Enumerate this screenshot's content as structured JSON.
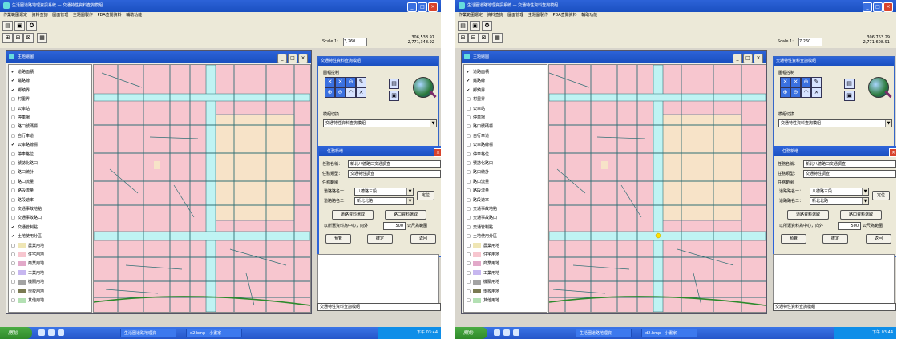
{
  "screens": [
    {
      "title": "生活圈道路地理資訊系統 — 交通特性資料查詢模組",
      "menu": [
        "作業範圍選定",
        "資料查詢",
        "圖面管理",
        "主題圖製作",
        "PDA查閱資料",
        "輔助功能"
      ],
      "scale_label": "Scale 1:",
      "scale_value": "7,260",
      "coord_x": "306,538.97",
      "coord_y": "2,771,348.92",
      "map_window_title": "主題繪圖",
      "layers": [
        {
          "label": "道路面積",
          "checked": true,
          "swatch": ""
        },
        {
          "label": "鐵路線",
          "checked": true,
          "swatch": ""
        },
        {
          "label": "鄉鎮界",
          "checked": true,
          "swatch": ""
        },
        {
          "label": "村里界",
          "checked": false,
          "swatch": ""
        },
        {
          "label": "公車站",
          "checked": false,
          "swatch": ""
        },
        {
          "label": "停車場",
          "checked": false,
          "swatch": ""
        },
        {
          "label": "路口號碼標",
          "checked": false,
          "swatch": ""
        },
        {
          "label": "自行車道",
          "checked": false,
          "swatch": ""
        },
        {
          "label": "公車路線標",
          "checked": true,
          "swatch": ""
        },
        {
          "label": "停車格位",
          "checked": false,
          "swatch": ""
        },
        {
          "label": "號誌化路口",
          "checked": false,
          "swatch": ""
        },
        {
          "label": "路口統計",
          "checked": false,
          "swatch": ""
        },
        {
          "label": "路口流量",
          "checked": false,
          "swatch": ""
        },
        {
          "label": "路段流量",
          "checked": false,
          "swatch": ""
        },
        {
          "label": "路段速率",
          "checked": false,
          "swatch": ""
        },
        {
          "label": "交通事故地點",
          "checked": false,
          "swatch": ""
        },
        {
          "label": "交通事故路口",
          "checked": false,
          "swatch": ""
        },
        {
          "label": "交通管制點",
          "checked": true,
          "swatch": ""
        },
        {
          "label": "土地使用分區",
          "checked": true,
          "swatch": ""
        },
        {
          "label": "農業用地",
          "checked": false,
          "swatch": "#efe6b5"
        },
        {
          "label": "住宅用地",
          "checked": false,
          "swatch": "#f7c6cf"
        },
        {
          "label": "商業用地",
          "checked": false,
          "swatch": "#e2a9c9"
        },
        {
          "label": "工業用地",
          "checked": false,
          "swatch": "#c7b7f0"
        },
        {
          "label": "機關用地",
          "checked": false,
          "swatch": "#a3a3a3"
        },
        {
          "label": "學校用地",
          "checked": false,
          "swatch": "#7a7a52"
        },
        {
          "label": "其他用地",
          "checked": false,
          "swatch": "#b3e0b3"
        }
      ],
      "panel_title": "交通特性資料查詢模組",
      "panel_tools_label": "圖幅控制",
      "panel_mode_label": "模組切換",
      "panel_mode_value": "交通特性資料查詢模組",
      "dialog_title": "任務新增",
      "task_name_label": "任務名稱：",
      "task_name_value": "新北八德路口交通調查",
      "task_type_label": "任務類型：",
      "task_type_value": "交通特性調查",
      "task_range_label": "任務範圍",
      "road1_label": "道路路名一：",
      "road1_value": "八德路三段",
      "road2_label": "道路路名二：",
      "road2_value": "新北北路",
      "locate_label": "定位",
      "select_road_label": "道路資料選取",
      "select_intersection_label": "路口資料選取",
      "radius_label": "以所選資料為中心，向外",
      "radius_value": "500",
      "radius_unit": "公尺為範圍",
      "preview_label": "預覽",
      "ok_label": "確定",
      "back_label": "返回",
      "bottom_select_value": "交通特性資料查詢模組",
      "start_label": "開始",
      "task1": "生活圈道路地理資",
      "task2": "d2.bmp - 小畫家",
      "clock": "下午 03:44"
    },
    {
      "title": "生活圈道路地理資訊系統 — 交通特性資料查詢模組",
      "menu": [
        "作業範圍選定",
        "資料查詢",
        "圖面管理",
        "主題圖製作",
        "PDA查閱資料",
        "輔助功能"
      ],
      "scale_label": "Scale 1:",
      "scale_value": "7,260",
      "coord_x": "306,763.29",
      "coord_y": "2,771,608.91",
      "map_window_title": "主題繪圖",
      "layers": [
        {
          "label": "道路面積",
          "checked": true,
          "swatch": ""
        },
        {
          "label": "鐵路線",
          "checked": true,
          "swatch": ""
        },
        {
          "label": "鄉鎮界",
          "checked": true,
          "swatch": ""
        },
        {
          "label": "村里界",
          "checked": false,
          "swatch": ""
        },
        {
          "label": "公車站",
          "checked": false,
          "swatch": ""
        },
        {
          "label": "停車場",
          "checked": false,
          "swatch": ""
        },
        {
          "label": "路口號碼標",
          "checked": false,
          "swatch": ""
        },
        {
          "label": "自行車道",
          "checked": false,
          "swatch": ""
        },
        {
          "label": "公車路線標",
          "checked": false,
          "swatch": ""
        },
        {
          "label": "停車格位",
          "checked": false,
          "swatch": ""
        },
        {
          "label": "號誌化路口",
          "checked": false,
          "swatch": ""
        },
        {
          "label": "路口統計",
          "checked": false,
          "swatch": ""
        },
        {
          "label": "路口流量",
          "checked": false,
          "swatch": ""
        },
        {
          "label": "路段流量",
          "checked": false,
          "swatch": ""
        },
        {
          "label": "路段速率",
          "checked": false,
          "swatch": ""
        },
        {
          "label": "交通事故地點",
          "checked": false,
          "swatch": ""
        },
        {
          "label": "交通事故路口",
          "checked": false,
          "swatch": ""
        },
        {
          "label": "交通管制點",
          "checked": false,
          "swatch": ""
        },
        {
          "label": "土地使用分區",
          "checked": false,
          "swatch": ""
        },
        {
          "label": "農業用地",
          "checked": false,
          "swatch": "#efe6b5"
        },
        {
          "label": "住宅用地",
          "checked": false,
          "swatch": "#f7c6cf"
        },
        {
          "label": "商業用地",
          "checked": false,
          "swatch": "#e2a9c9"
        },
        {
          "label": "工業用地",
          "checked": false,
          "swatch": "#c7b7f0"
        },
        {
          "label": "機關用地",
          "checked": false,
          "swatch": "#a3a3a3"
        },
        {
          "label": "學校用地",
          "checked": false,
          "swatch": "#7a7a52"
        },
        {
          "label": "其他用地",
          "checked": false,
          "swatch": "#b3e0b3"
        }
      ],
      "panel_title": "交通特性資料查詢模組",
      "panel_tools_label": "圖幅控制",
      "panel_mode_label": "模組切換",
      "panel_mode_value": "交通特性資料查詢模組",
      "dialog_title": "任務新增",
      "task_name_label": "任務名稱：",
      "task_name_value": "新北八德路口交通調查",
      "task_type_label": "任務類型：",
      "task_type_value": "交通特性調查",
      "task_range_label": "任務範圍",
      "road1_label": "道路路名一：",
      "road1_value": "八德路三段",
      "road2_label": "道路路名二：",
      "road2_value": "新北北路",
      "locate_label": "定位",
      "select_road_label": "道路資料選取",
      "select_intersection_label": "路口資料選取",
      "radius_label": "以所選資料為中心，向外",
      "radius_value": "500",
      "radius_unit": "公尺為範圍",
      "preview_label": "預覽",
      "ok_label": "確定",
      "back_label": "返回",
      "bottom_select_value": "交通特性資料查詢模組",
      "start_label": "開始",
      "task1": "生活圈道路地理資",
      "task2": "d2.bmp - 小畫家",
      "clock": "下午 03:44"
    }
  ],
  "colors": {
    "road": "#bff3f3",
    "block": "#f7c6cf",
    "road_edge": "#2f6f74",
    "big_lot": "#f7e3c8",
    "title_blue": "#1a4fc0",
    "rail": "#2c8a2c"
  }
}
